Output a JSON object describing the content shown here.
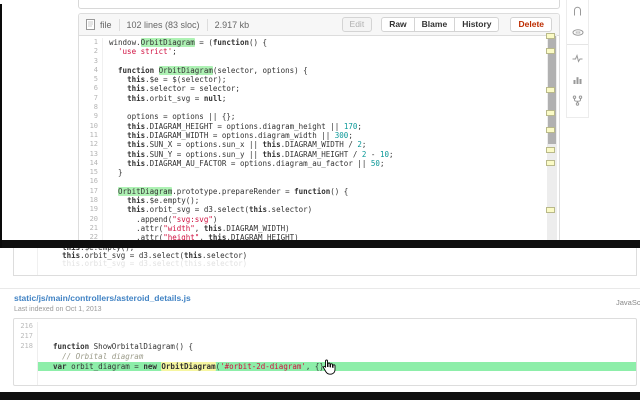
{
  "colors": {
    "link_blue": "#4183c4",
    "match_highlight_green": "#aef2b4",
    "row_highlight_green": "#8deea9",
    "token_highlight_yellow": "#f6f6a0",
    "string_red": "#d01040",
    "number_teal": "#0a9898",
    "delete_red": "#bd2c00"
  },
  "icons": {
    "file": "file-icon",
    "toolbar": [
      "book-icon",
      "counter-icon",
      "pulse-icon",
      "graphs-icon",
      "network-icon"
    ]
  },
  "file_view": {
    "header": {
      "file_label": "file",
      "stats": "102 lines (83 sloc)",
      "size": "2.917 kb",
      "buttons": {
        "edit": "Edit",
        "raw": "Raw",
        "blame": "Blame",
        "history": "History",
        "delete": "Delete"
      }
    },
    "code_lines": [
      {
        "num": "1",
        "segs": [
          [
            "window.",
            ""
          ],
          [
            "OrbitDiagram",
            "hg"
          ],
          [
            " = (",
            ""
          ],
          [
            "function",
            "k"
          ],
          [
            "() {",
            ""
          ]
        ]
      },
      {
        "num": "2",
        "segs": [
          [
            "  ",
            ""
          ],
          [
            "'use strict'",
            "s"
          ],
          [
            ";",
            ""
          ]
        ]
      },
      {
        "num": "3",
        "segs": []
      },
      {
        "num": "4",
        "segs": [
          [
            "  ",
            ""
          ],
          [
            "function",
            "k"
          ],
          [
            " ",
            ""
          ],
          [
            "OrbitDiagram",
            "hg"
          ],
          [
            "(selector, options) {",
            ""
          ]
        ]
      },
      {
        "num": "5",
        "segs": [
          [
            "    ",
            ""
          ],
          [
            "this",
            "k"
          ],
          [
            ".$e = $(selector);",
            ""
          ]
        ]
      },
      {
        "num": "6",
        "segs": [
          [
            "    ",
            ""
          ],
          [
            "this",
            "k"
          ],
          [
            ".selector = selector;",
            ""
          ]
        ]
      },
      {
        "num": "7",
        "segs": [
          [
            "    ",
            ""
          ],
          [
            "this",
            "k"
          ],
          [
            ".orbit_svg = ",
            ""
          ],
          [
            "null",
            "k"
          ],
          [
            ";",
            ""
          ]
        ]
      },
      {
        "num": "8",
        "segs": []
      },
      {
        "num": "9",
        "segs": [
          [
            "    options = options || {};",
            ""
          ]
        ]
      },
      {
        "num": "10",
        "segs": [
          [
            "    ",
            ""
          ],
          [
            "this",
            "k"
          ],
          [
            ".DIAGRAM_HEIGHT = options.diagram_height || ",
            ""
          ],
          [
            "170",
            "n"
          ],
          [
            ";",
            ""
          ]
        ]
      },
      {
        "num": "11",
        "segs": [
          [
            "    ",
            ""
          ],
          [
            "this",
            "k"
          ],
          [
            ".DIAGRAM_WIDTH = options.diagram_width || ",
            ""
          ],
          [
            "300",
            "n"
          ],
          [
            ";",
            ""
          ]
        ]
      },
      {
        "num": "12",
        "segs": [
          [
            "    ",
            ""
          ],
          [
            "this",
            "k"
          ],
          [
            ".SUN_X = options.sun_x || ",
            ""
          ],
          [
            "this",
            "k"
          ],
          [
            ".DIAGRAM_WIDTH / ",
            ""
          ],
          [
            "2",
            "n"
          ],
          [
            ";",
            ""
          ]
        ]
      },
      {
        "num": "13",
        "segs": [
          [
            "    ",
            ""
          ],
          [
            "this",
            "k"
          ],
          [
            ".SUN_Y = options.sun_y || ",
            ""
          ],
          [
            "this",
            "k"
          ],
          [
            ".DIAGRAM_HEIGHT / ",
            ""
          ],
          [
            "2",
            "n"
          ],
          [
            " - ",
            ""
          ],
          [
            "10",
            "n"
          ],
          [
            ";",
            ""
          ]
        ]
      },
      {
        "num": "14",
        "segs": [
          [
            "    ",
            ""
          ],
          [
            "this",
            "k"
          ],
          [
            ".DIAGRAM_AU_FACTOR = options.diagram_au_factor || ",
            ""
          ],
          [
            "50",
            "n"
          ],
          [
            ";",
            ""
          ]
        ]
      },
      {
        "num": "15",
        "segs": [
          [
            "  }",
            ""
          ]
        ]
      },
      {
        "num": "16",
        "segs": []
      },
      {
        "num": "17",
        "segs": [
          [
            "  ",
            ""
          ],
          [
            "OrbitDiagram",
            "hg"
          ],
          [
            ".prototype.prepareRender = ",
            ""
          ],
          [
            "function",
            "k"
          ],
          [
            "() {",
            ""
          ]
        ]
      },
      {
        "num": "18",
        "segs": [
          [
            "    ",
            ""
          ],
          [
            "this",
            "k"
          ],
          [
            ".$e.empty();",
            ""
          ]
        ]
      },
      {
        "num": "19",
        "segs": [
          [
            "    ",
            ""
          ],
          [
            "this",
            "k"
          ],
          [
            ".orbit_svg = d3.select(",
            ""
          ],
          [
            "this",
            "k"
          ],
          [
            ".selector)",
            ""
          ]
        ]
      },
      {
        "num": "20",
        "segs": [
          [
            "      .append(",
            ""
          ],
          [
            "\"svg:svg\"",
            "s"
          ],
          [
            ")",
            ""
          ]
        ]
      },
      {
        "num": "21",
        "segs": [
          [
            "      .attr(",
            ""
          ],
          [
            "\"width\"",
            "s"
          ],
          [
            ", ",
            ""
          ],
          [
            "this",
            "k"
          ],
          [
            ".DIAGRAM_WIDTH)",
            ""
          ]
        ]
      },
      {
        "num": "22",
        "segs": [
          [
            "      .attr(",
            ""
          ],
          [
            "\"height\"",
            "s"
          ],
          [
            ", ",
            ""
          ],
          [
            "this",
            "k"
          ],
          [
            ".DIAGRAM_HEIGHT)",
            ""
          ]
        ]
      }
    ],
    "scrollbar_marker_ys": [
      33,
      48,
      87,
      110,
      127,
      147,
      160,
      207
    ]
  },
  "search_results": {
    "partial_snippet_lines": [
      {
        "num": "",
        "segs": [
          [
            "    ",
            ""
          ],
          [
            "this",
            "k"
          ],
          [
            ".$e.empty();",
            ""
          ]
        ]
      },
      {
        "num": "",
        "segs": [
          [
            "    ",
            ""
          ],
          [
            "this",
            "k"
          ],
          [
            ".orbit_svg = d3.select(",
            ""
          ],
          [
            "this",
            "k"
          ],
          [
            ".selector)",
            ""
          ]
        ]
      },
      {
        "num": "",
        "segs": [
          [
            "    this.orbit_svg = d3.select(this.selector)",
            "g"
          ]
        ]
      }
    ],
    "result": {
      "path": "static/js/main/controllers/asteroid_details.js",
      "meta": "Last indexed on Oct 1, 2013",
      "language": "JavaScript",
      "rows": [
        {
          "num": "216",
          "segs": []
        },
        {
          "num": "217",
          "segs": []
        },
        {
          "num": "218",
          "segs": [
            [
              "  ",
              ""
            ],
            [
              "function",
              "k"
            ],
            [
              " ShowOrbitalDiagram() {",
              ""
            ]
          ]
        },
        {
          "num": "",
          "segs": [
            [
              "    ",
              ""
            ],
            [
              "// Orbital diagram",
              "c"
            ]
          ]
        },
        {
          "num": "",
          "green": true,
          "segs": [
            [
              "  ",
              ""
            ],
            [
              "var",
              "k"
            ],
            [
              " orbit_diagram = ",
              ""
            ],
            [
              "new",
              "k"
            ],
            [
              " ",
              ""
            ],
            [
              "OrbitDiagram",
              "hy"
            ],
            [
              "(",
              ""
            ],
            [
              "'#orbit-2d-diagram'",
              "s"
            ],
            [
              ", {});",
              ""
            ]
          ]
        },
        {
          "num": "",
          "segs": []
        },
        {
          "num": "",
          "segs": []
        }
      ]
    }
  }
}
